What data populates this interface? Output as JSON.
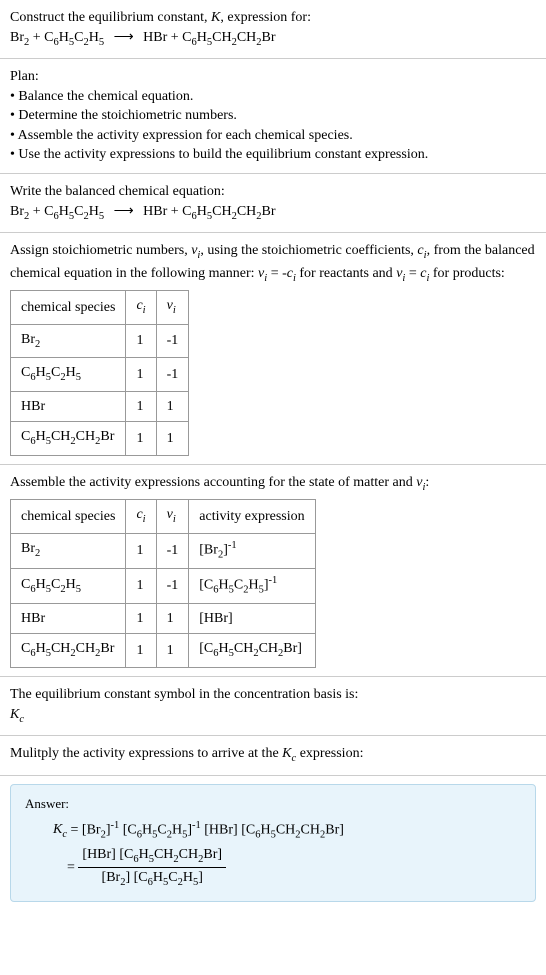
{
  "section1": {
    "title": "Construct the equilibrium constant, K, expression for:",
    "equation_lhs": "Br₂ + C₆H₅C₂H₅",
    "equation_rhs": "HBr + C₆H₅CH₂CH₂Br"
  },
  "section2": {
    "title": "Plan:",
    "bullets": [
      "Balance the chemical equation.",
      "Determine the stoichiometric numbers.",
      "Assemble the activity expression for each chemical species.",
      "Use the activity expressions to build the equilibrium constant expression."
    ]
  },
  "section3": {
    "title": "Write the balanced chemical equation:",
    "equation_lhs": "Br₂ + C₆H₅C₂H₅",
    "equation_rhs": "HBr + C₆H₅CH₂CH₂Br"
  },
  "section4": {
    "intro": "Assign stoichiometric numbers, νᵢ, using the stoichiometric coefficients, cᵢ, from the balanced chemical equation in the following manner: νᵢ = -cᵢ for reactants and νᵢ = cᵢ for products:",
    "headers": [
      "chemical species",
      "cᵢ",
      "νᵢ"
    ],
    "rows": [
      [
        "Br₂",
        "1",
        "-1"
      ],
      [
        "C₆H₅C₂H₅",
        "1",
        "-1"
      ],
      [
        "HBr",
        "1",
        "1"
      ],
      [
        "C₆H₅CH₂CH₂Br",
        "1",
        "1"
      ]
    ]
  },
  "section5": {
    "intro": "Assemble the activity expressions accounting for the state of matter and νᵢ:",
    "headers": [
      "chemical species",
      "cᵢ",
      "νᵢ",
      "activity expression"
    ],
    "rows": [
      {
        "species": "Br₂",
        "c": "1",
        "v": "-1",
        "expr_base": "[Br₂]",
        "expr_sup": "-1"
      },
      {
        "species": "C₆H₅C₂H₅",
        "c": "1",
        "v": "-1",
        "expr_base": "[C₆H₅C₂H₅]",
        "expr_sup": "-1"
      },
      {
        "species": "HBr",
        "c": "1",
        "v": "1",
        "expr_base": "[HBr]",
        "expr_sup": ""
      },
      {
        "species": "C₆H₅CH₂CH₂Br",
        "c": "1",
        "v": "1",
        "expr_base": "[C₆H₅CH₂CH₂Br]",
        "expr_sup": ""
      }
    ]
  },
  "section6": {
    "line1": "The equilibrium constant symbol in the concentration basis is:",
    "line2": "K_c"
  },
  "section7": {
    "text": "Mulitply the activity expressions to arrive at the K_c expression:"
  },
  "answer": {
    "label": "Answer:",
    "kc": "K_c",
    "eq1_part1": "[Br₂]",
    "eq1_sup1": "-1",
    "eq1_part2": "[C₆H₅C₂H₅]",
    "eq1_sup2": "-1",
    "eq1_part3": "[HBr] [C₆H₅CH₂CH₂Br]",
    "frac_num": "[HBr] [C₆H₅CH₂CH₂Br]",
    "frac_den": "[Br₂] [C₆H₅C₂H₅]"
  }
}
